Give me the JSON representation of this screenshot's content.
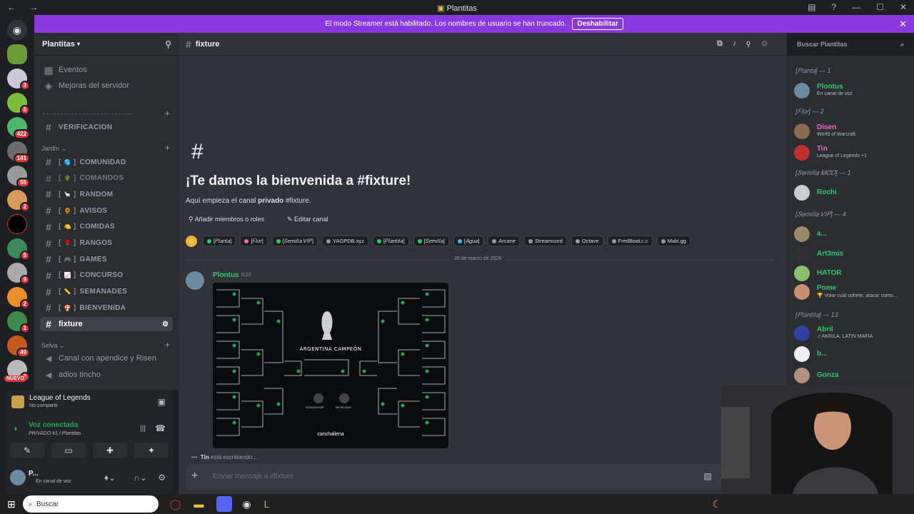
{
  "window": {
    "title": "Plantitas",
    "nav_icons": "← →",
    "controls": [
      "—",
      "☐",
      "✕"
    ]
  },
  "banner": {
    "text": "El modo Streamer está habilitado. Los nombres de usuario se han truncado.",
    "button": "Deshabilitar"
  },
  "server_list": {
    "badges": [
      "3",
      "5",
      "422",
      "141",
      "55",
      "2",
      "5",
      "9",
      "2",
      "1",
      "49",
      "3"
    ],
    "new_label": "NUEVO"
  },
  "sidebar": {
    "server_name": "Plantitas",
    "top_items": [
      "Eventos",
      "Mejoras del servidor"
    ],
    "verify_channel": "VERIFICACION",
    "category_jardin": "Jardín",
    "channels": [
      {
        "name": "COMUNIDAD",
        "emoji": "🌎"
      },
      {
        "name": "COMANDOS",
        "emoji": "🌵"
      },
      {
        "name": "RANDOM",
        "emoji": "🦙"
      },
      {
        "name": "AVISOS",
        "emoji": "🌻"
      },
      {
        "name": "COMIDAS",
        "emoji": "🍋"
      },
      {
        "name": "RANGOS",
        "emoji": "🌹"
      },
      {
        "name": "GAMES",
        "emoji": "🎮"
      },
      {
        "name": "CONCURSO",
        "emoji": "📈"
      },
      {
        "name": "SEMANADES",
        "emoji": "📏"
      },
      {
        "name": "BIENVENIDA",
        "emoji": "🍄"
      }
    ],
    "active_channel": "fixture",
    "category_selva": "Selva",
    "voice_channels": [
      "Canal con apendice y Risen",
      "adios tincho"
    ]
  },
  "panel": {
    "activity_game": "League of Legends",
    "activity_sub": "No compartir",
    "voice_status": "Voz conectada",
    "voice_channel": "PRIVADO #1 / Plantitas",
    "user_name": "P...",
    "user_status": "En canal de voz"
  },
  "channel_header": {
    "name": "fixture",
    "search_placeholder": "Buscar Plantitas"
  },
  "welcome": {
    "title": "¡Te damos la bienvenida a #fixture!",
    "sub_prefix": "Aquí empieza el canal ",
    "sub_bold": "privado",
    "sub_suffix": " #fixture.",
    "add_members": "Añadir miembros o roles",
    "edit_channel": "Editar canal"
  },
  "role_tags": [
    {
      "name": "[𝑃𝑙𝑎𝑛𝑡𝑎]",
      "color": "#2dc770"
    },
    {
      "name": "[𝐹𝑙𝑜𝑟]",
      "color": "#e86cc4"
    },
    {
      "name": "[𝑆𝑒𝑚𝑖𝑙𝑙𝑎 𝑉𝐼𝑃]",
      "color": "#2dc770"
    },
    {
      "name": "YAGPDB.xyz",
      "color": "#949ba4"
    },
    {
      "name": "[𝑃𝑙𝑎𝑛𝑡𝑖𝑡𝑎]",
      "color": "#2dc770"
    },
    {
      "name": "[𝑆𝑒𝑚𝑖𝑙𝑙𝑎]",
      "color": "#2dc770"
    },
    {
      "name": "[𝐴𝑔𝑢𝑎]",
      "color": "#3ebbe8"
    },
    {
      "name": "Arcane",
      "color": "#949ba4"
    },
    {
      "name": "Streamcord",
      "color": "#949ba4"
    },
    {
      "name": "Octave",
      "color": "#949ba4"
    },
    {
      "name": "FredBoat♫♫",
      "color": "#949ba4"
    },
    {
      "name": "Maki.gg",
      "color": "#949ba4"
    }
  ],
  "date_divider": "26 de marzo de 2026",
  "message": {
    "author": "Plontus",
    "time": "0:22",
    "image_caption": "ARGENTINA CAMPEÓN",
    "image_brand": "canchallena",
    "image_labels": [
      "GONZASHOP",
      "BETALIDAD"
    ]
  },
  "typing": {
    "user": "Tin",
    "text": " está escribiendo..."
  },
  "composer": {
    "placeholder": "Enviar mensaje a #fixture"
  },
  "members": {
    "groups": [
      {
        "label": "[𝑃𝑙𝑎𝑛𝑡𝑎] — 1"
      },
      {
        "label": "[𝐹𝑙𝑜𝑟] — 2"
      },
      {
        "label": "[𝑆𝑒𝑚𝑖𝑙𝑙𝑎 𝑀𝑂𝐷] — 1"
      },
      {
        "label": "[𝑆𝑒𝑚𝑖𝑙𝑙𝑎 𝑉𝐼𝑃] — 4"
      },
      {
        "label": "[𝑃𝑙𝑎𝑛𝑡𝑖𝑡𝑎] — 13"
      }
    ],
    "list": [
      {
        "name": "Plontus",
        "activity": "En canal de voz",
        "color": "#2dc770"
      },
      {
        "name": "Disen",
        "activity": "World of Warcraft",
        "color": "#e86cc4"
      },
      {
        "name": "Tin",
        "activity": "League of Legends +1",
        "color": "#e86cc4"
      },
      {
        "name": "Rochi",
        "activity": "",
        "color": "#2dc770"
      },
      {
        "name": "a...",
        "activity": "",
        "color": "#2dc770"
      },
      {
        "name": "Art3mis",
        "activity": "",
        "color": "#2dc770"
      },
      {
        "name": "HATOR",
        "activity": "",
        "color": "#2dc770"
      },
      {
        "name": "Pome",
        "activity": "🏆 Volar cual cohete, atacar como...",
        "color": "#2dc770"
      },
      {
        "name": "Abril",
        "activity": "♫ AKRILA, LATIN MAFIA",
        "color": "#2dc770"
      },
      {
        "name": "b...",
        "activity": "",
        "color": "#2dc770"
      },
      {
        "name": "Gonza",
        "activity": "",
        "color": "#2dc770"
      }
    ]
  },
  "taskbar": {
    "search": "Buscar"
  }
}
